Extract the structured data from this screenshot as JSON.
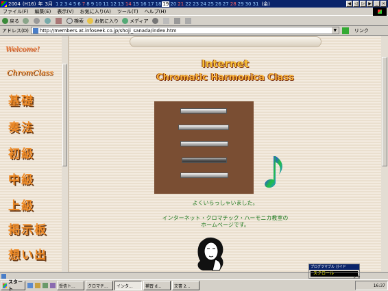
{
  "calendar": {
    "year_label": "2004",
    "era": "(H16)",
    "year_suffix": "年",
    "month": "3月",
    "days": [
      "1",
      "2",
      "3",
      "4",
      "5",
      "6",
      "7",
      "8",
      "9",
      "10",
      "11",
      "12",
      "13",
      "14",
      "15",
      "16",
      "17",
      "18",
      "19",
      "20",
      "21",
      "22",
      "23",
      "24",
      "25",
      "26",
      "27",
      "28",
      "29",
      "30",
      "31"
    ],
    "weekday": "(金)"
  },
  "menu": {
    "items": [
      "ファイル(F)",
      "編集(E)",
      "表示(V)",
      "お気に入り(A)",
      "ツール(T)",
      "ヘルプ(H)"
    ]
  },
  "toolbar": {
    "back_label": "戻る",
    "search_label": "検索",
    "favorites_label": "お気に入り",
    "media_label": "メディア"
  },
  "address": {
    "label": "アドレス(D)",
    "url": "http://members.at.infoseek.co.jp/shoji_sanada/index.htm",
    "links_label": "リンク"
  },
  "sidebar": {
    "welcome": "Welcome!",
    "class_name": "ChromClass",
    "nav": [
      "基礎",
      "奏法",
      "初級",
      "中級",
      "上級",
      "掲示板",
      "想い出"
    ]
  },
  "main": {
    "title_line1": "Internet",
    "title_line2": "Chromatic Harmonica Class",
    "welcome_text": "よくいらっしゃいました。",
    "intro_line1": "インターネット・クロマチック・ハーモニカ教室の",
    "intro_line2": "ホームページです。"
  },
  "ime": {
    "header": "プログラマブル ガイド",
    "scroll_label": "スクロール"
  },
  "status": {
    "zone_label": "ット"
  },
  "taskbar": {
    "start_label": "スタート",
    "tasks": [
      "受信ト...",
      "クロマチ...",
      "インタ...",
      "補習 d...",
      "文書 2..."
    ],
    "clock": "16:37"
  }
}
